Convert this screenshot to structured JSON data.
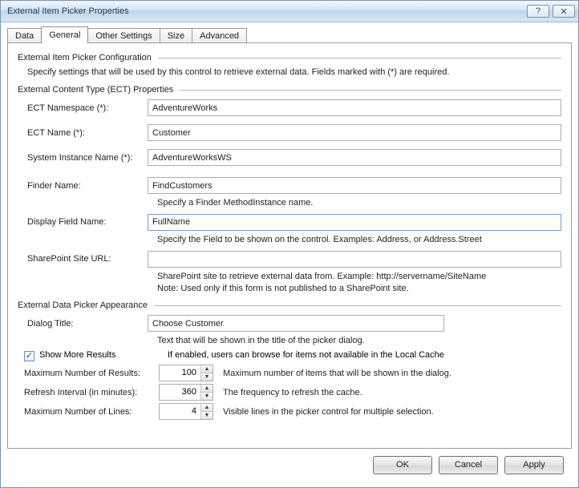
{
  "window": {
    "title": "External Item Picker Properties"
  },
  "tabs": {
    "data": "Data",
    "general": "General",
    "other": "Other Settings",
    "size": "Size",
    "advanced": "Advanced"
  },
  "section1": {
    "title": "External Item Picker Configuration",
    "desc": "Specify settings that will be used by this control to retrieve external data. Fields marked with (*) are required."
  },
  "section2": {
    "title": "External Content Type (ECT) Properties",
    "ect_namespace_label": "ECT Namespace (*):",
    "ect_namespace_value": "AdventureWorks",
    "ect_name_label": "ECT Name (*):",
    "ect_name_value": "Customer",
    "system_instance_label": "System Instance Name (*):",
    "system_instance_value": "AdventureWorksWS",
    "finder_label": "Finder Name:",
    "finder_value": "FindCustomers",
    "finder_hint": "Specify a Finder MethodInstance name.",
    "display_field_label": "Display Field Name:",
    "display_field_value": "FullName",
    "display_field_hint": "Specify the Field to be shown on the control. Examples: Address, or Address.Street",
    "site_url_label": "SharePoint Site URL:",
    "site_url_value": "",
    "site_url_hint": "SharePoint site to retrieve external data from. Example: http://servername/SiteName\nNote: Used only if this form is not published to a SharePoint site."
  },
  "section3": {
    "title": "External Data Picker Appearance",
    "dialog_title_label": "Dialog Title:",
    "dialog_title_value": "Choose Customer",
    "dialog_title_hint": "Text that will be shown in the title of the picker dialog.",
    "show_more_label": "Show More Results",
    "show_more_hint": "If enabled, users can browse for items not available in the Local Cache",
    "max_results_label": "Maximum Number of Results:",
    "max_results_value": "100",
    "max_results_hint": "Maximum number of items that will be shown in the dialog.",
    "refresh_label": "Refresh Interval (in minutes):",
    "refresh_value": "360",
    "refresh_hint": "The frequency to refresh the cache.",
    "max_lines_label": "Maximum Number of Lines:",
    "max_lines_value": "4",
    "max_lines_hint": "Visible lines in the picker control for multiple selection."
  },
  "buttons": {
    "ok": "OK",
    "cancel": "Cancel",
    "apply": "Apply"
  }
}
